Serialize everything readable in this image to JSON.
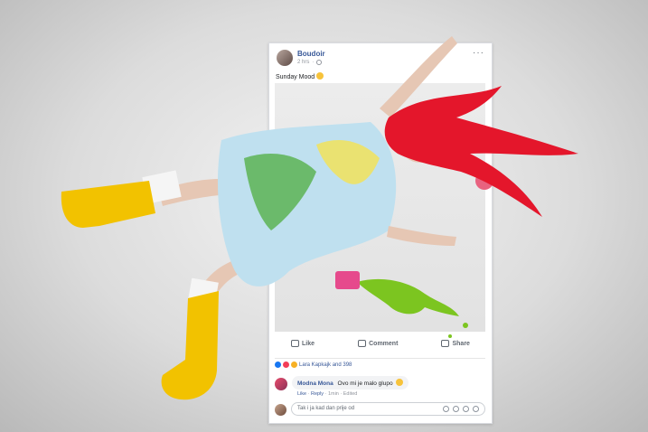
{
  "post": {
    "page_name": "Boudoir",
    "time": "2 hrs",
    "text": "Sunday Mood",
    "text_emoji": "smiling-face-emoji",
    "more_icon": "more-dots-icon"
  },
  "actions": {
    "like": "Like",
    "comment": "Comment",
    "share": "Share"
  },
  "reactions": {
    "icons": [
      "like-reaction-icon",
      "love-reaction-icon",
      "wow-reaction-icon"
    ],
    "summary": "Lara Kapkajk and 398"
  },
  "comment": {
    "author": "Modna Mona",
    "text": "Ovo mi je malo glupo",
    "like": "Like",
    "reply": "Reply",
    "time": "1min",
    "edited": "Edited"
  },
  "reply_box": {
    "value": "Tak i ja kad dan prije od"
  },
  "colors": {
    "link_blue": "#385898",
    "boot_yellow": "#f2c200",
    "hair_red": "#e4162b",
    "paint_green": "#7cc520",
    "cup_pink": "#e64a8c"
  }
}
